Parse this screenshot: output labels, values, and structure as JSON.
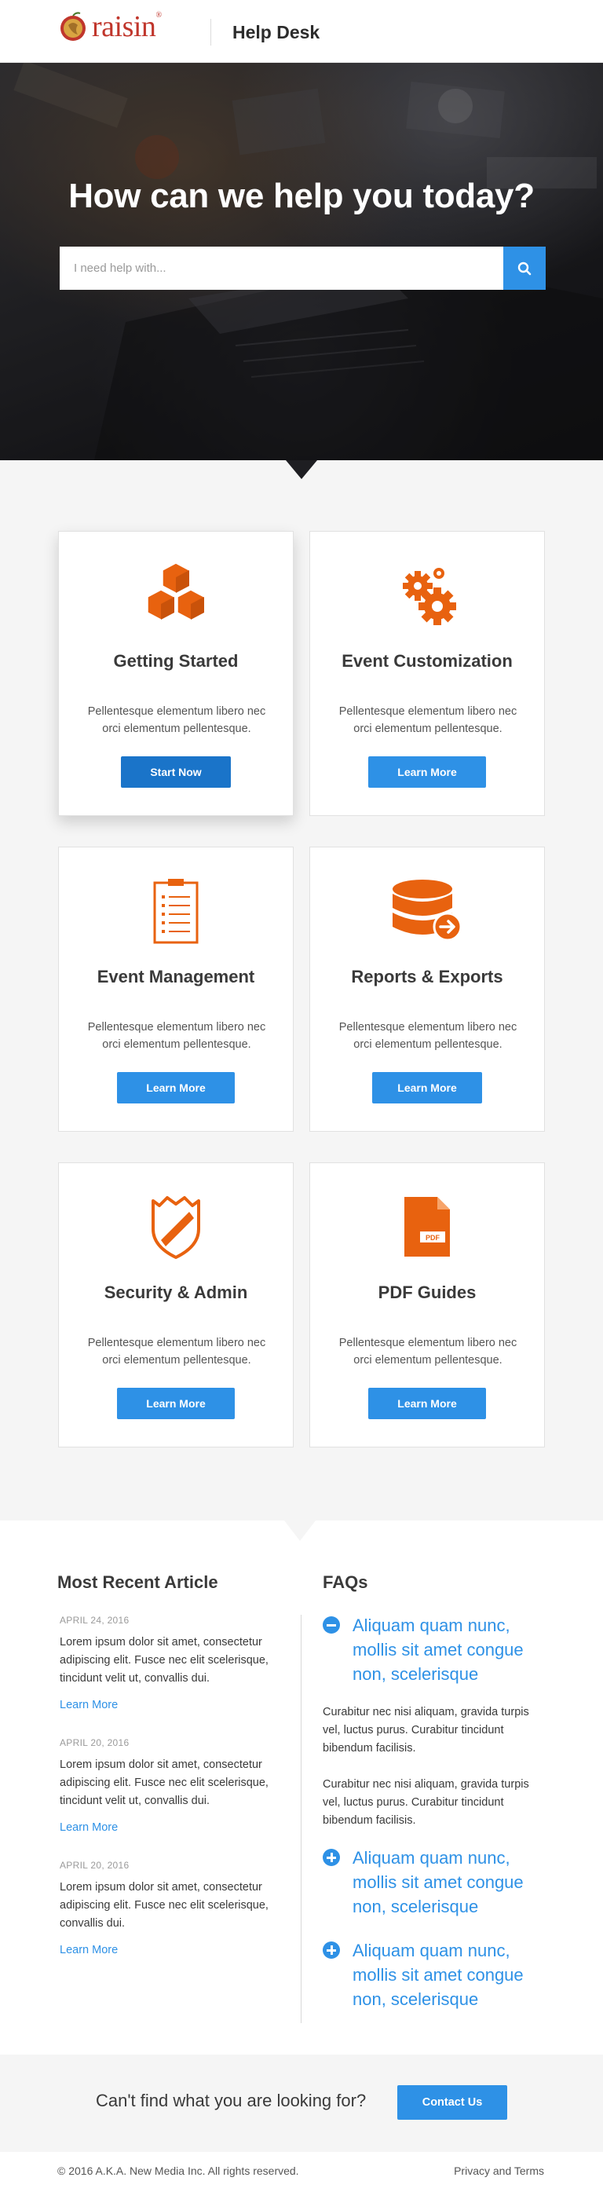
{
  "header": {
    "logo_text": "raisin",
    "logo_trademark": "®",
    "title": "Help Desk"
  },
  "hero": {
    "heading": "How can we help you today?",
    "search_placeholder": "I need help with...",
    "search_icon": "search-icon"
  },
  "categories": [
    {
      "title": "Getting Started",
      "description": "Pellentesque elementum libero nec orci elementum pellentesque.",
      "button": "Start Now",
      "icon": "cubes-icon"
    },
    {
      "title": "Event Customization",
      "description": "Pellentesque elementum libero nec orci elementum pellentesque.",
      "button": "Learn More",
      "icon": "gears-icon"
    },
    {
      "title": "Event Management",
      "description": "Pellentesque elementum libero nec orci elementum pellentesque.",
      "button": "Learn More",
      "icon": "clipboard-list-icon"
    },
    {
      "title": "Reports & Exports",
      "description": "Pellentesque elementum libero nec orci elementum pellentesque.",
      "button": "Learn More",
      "icon": "database-export-icon"
    },
    {
      "title": "Security & Admin",
      "description": "Pellentesque elementum libero nec orci elementum pellentesque.",
      "button": "Learn More",
      "icon": "shield-icon"
    },
    {
      "title": "PDF Guides",
      "description": "Pellentesque elementum libero nec orci elementum pellentesque.",
      "button": "Learn More",
      "icon": "pdf-file-icon",
      "icon_label": "PDF"
    }
  ],
  "recent": {
    "title": "Most Recent Article",
    "articles": [
      {
        "date": "April 24, 2016",
        "text": "Lorem ipsum dolor sit amet, consectetur adipiscing elit. Fusce nec elit scelerisque, tincidunt velit ut, convallis dui.",
        "link": "Learn More"
      },
      {
        "date": "April 20, 2016",
        "text": "Lorem ipsum dolor sit amet, consectetur adipiscing elit. Fusce nec elit scelerisque, tincidunt velit ut, convallis dui.",
        "link": "Learn More"
      },
      {
        "date": "April 20, 2016",
        "text": "Lorem ipsum dolor sit amet, consectetur adipiscing elit. Fusce nec elit scelerisque, convallis dui.",
        "link": "Learn More"
      }
    ]
  },
  "faqs": {
    "title": "FAQs",
    "items": [
      {
        "question": "Aliquam quam nunc, mollis sit amet congue non, scelerisque",
        "expanded": true,
        "answers": [
          "Curabitur nec nisi aliquam, gravida turpis vel, luctus purus. Curabitur tincidunt bibendum facilisis.",
          "Curabitur nec nisi aliquam, gravida turpis vel, luctus purus. Curabitur tincidunt bibendum facilisis."
        ]
      },
      {
        "question": "Aliquam quam nunc, mollis sit amet congue non, scelerisque",
        "expanded": false
      },
      {
        "question": "Aliquam quam nunc, mollis sit amet congue non, scelerisque",
        "expanded": false
      }
    ]
  },
  "cta": {
    "text": "Can't find what you are looking for?",
    "button": "Contact Us"
  },
  "footer": {
    "copyright": "© 2016 A.K.A. New Media Inc. All rights reserved.",
    "link": "Privacy and Terms"
  },
  "colors": {
    "accent": "#2e91e6",
    "accent_dark": "#1a74c9",
    "icon_orange": "#e8620f",
    "brand_red": "#c0362c"
  }
}
